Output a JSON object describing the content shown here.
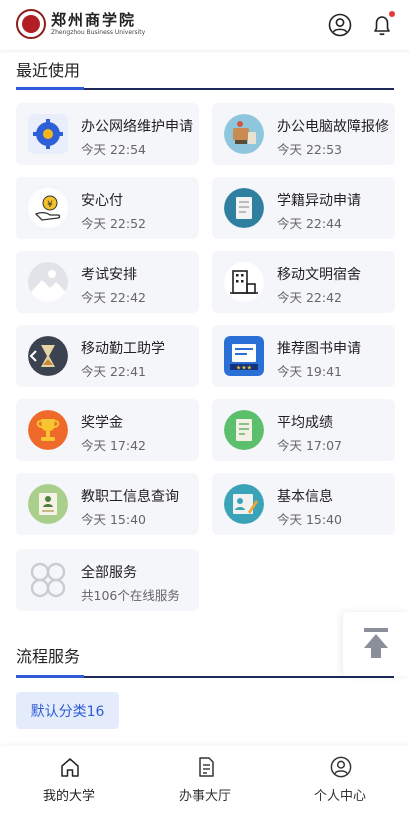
{
  "header": {
    "logo_cn": "郑州商学院",
    "logo_en": "Zhengzhou Business University",
    "icons": [
      "user-circle-icon",
      "bell-icon"
    ],
    "notification_dot_color": "#e53935"
  },
  "recent": {
    "title": "最近使用",
    "items": [
      {
        "name": "办公网络维护申请",
        "time": "今天 22:54",
        "icon": "gear-network-icon"
      },
      {
        "name": "办公电脑故障报修",
        "time": "今天 22:53",
        "icon": "computer-repair-icon"
      },
      {
        "name": "安心付",
        "time": "今天 22:52",
        "icon": "payment-hand-icon"
      },
      {
        "name": "学籍异动申请",
        "time": "今天 22:44",
        "icon": "student-record-icon"
      },
      {
        "name": "考试安排",
        "time": "今天 22:42",
        "icon": "exam-mountain-icon"
      },
      {
        "name": "移动文明宿舍",
        "time": "今天 22:42",
        "icon": "dormitory-building-icon"
      },
      {
        "name": "移动勤工助学",
        "time": "今天 22:41",
        "icon": "hourglass-icon"
      },
      {
        "name": "推荐图书申请",
        "time": "今天 19:41",
        "icon": "book-recommend-icon"
      },
      {
        "name": "奖学金",
        "time": "今天 17:42",
        "icon": "trophy-icon"
      },
      {
        "name": "平均成绩",
        "time": "今天 17:07",
        "icon": "grade-report-icon"
      },
      {
        "name": "教职工信息查询",
        "time": "今天 15:40",
        "icon": "staff-info-icon"
      },
      {
        "name": "基本信息",
        "time": "今天 15:40",
        "icon": "profile-edit-icon"
      }
    ],
    "all_services": {
      "name": "全部服务",
      "subtitle": "共106个在线服务",
      "icon": "grid-flower-icon"
    }
  },
  "process": {
    "title": "流程服务",
    "category_chip": "默认分类16"
  },
  "bottom_nav": [
    {
      "label": "我的大学",
      "icon": "home-icon"
    },
    {
      "label": "办事大厅",
      "icon": "document-icon"
    },
    {
      "label": "个人中心",
      "icon": "user-circle-icon"
    }
  ],
  "colors": {
    "accent": "#2f5bd8",
    "rule": "#1f2a5a",
    "card_bg": "#f5f6fa",
    "chip_bg": "#e4ecfb"
  }
}
